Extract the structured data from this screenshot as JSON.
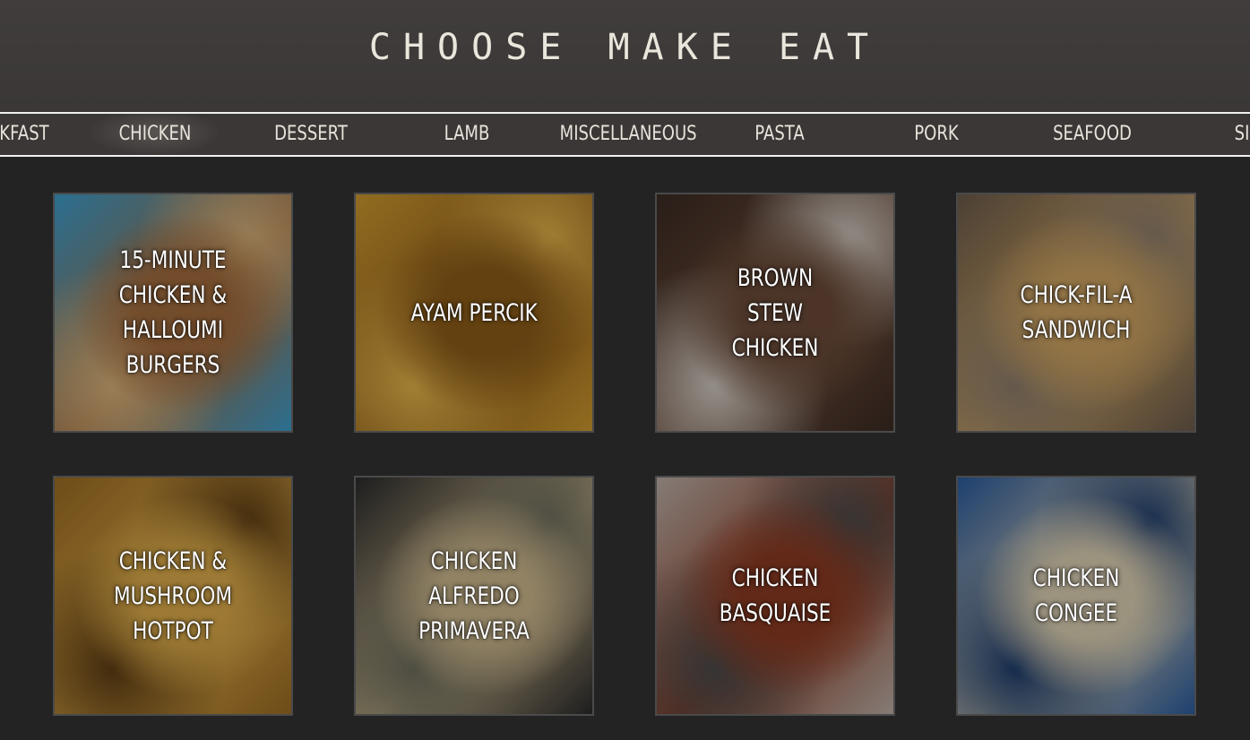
{
  "header": {
    "title": "CHOOSE MAKE EAT"
  },
  "nav": {
    "items": [
      {
        "label": "KFAST",
        "active": false
      },
      {
        "label": "CHICKEN",
        "active": true
      },
      {
        "label": "DESSERT",
        "active": false
      },
      {
        "label": "LAMB",
        "active": false
      },
      {
        "label": "MISCELLANEOUS",
        "active": false
      },
      {
        "label": "PASTA",
        "active": false
      },
      {
        "label": "PORK",
        "active": false
      },
      {
        "label": "SEAFOOD",
        "active": false
      },
      {
        "label": "SID",
        "active": false
      }
    ]
  },
  "recipes": [
    {
      "title": "15-MINUTE CHICKEN & HALLOUMI BURGERS",
      "image": "burger-on-board",
      "colors": [
        "#3c9ac8",
        "#a06a3c",
        "#d4b07a"
      ]
    },
    {
      "title": "AYAM PERCIK",
      "image": "grilled-chicken-fork",
      "colors": [
        "#c9962e",
        "#8a5a18",
        "#e2b44a"
      ]
    },
    {
      "title": "BROWN STEW CHICKEN",
      "image": "stew-bowl",
      "colors": [
        "#3a2a22",
        "#6a4a38",
        "#cfc8c0"
      ]
    },
    {
      "title": "CHICK-FIL-A SANDWICH",
      "image": "chicken-sandwich",
      "colors": [
        "#6a5a4a",
        "#c9a060",
        "#8a7a6a"
      ]
    },
    {
      "title": "CHICKEN & MUSHROOM HOTPOT",
      "image": "potato-hotpot",
      "colors": [
        "#9a6a22",
        "#d8a848",
        "#5a3a12"
      ]
    },
    {
      "title": "CHICKEN ALFREDO PRIMAVERA",
      "image": "pasta-skillet",
      "colors": [
        "#2a2a2a",
        "#c8b48a",
        "#6a6a5a"
      ]
    },
    {
      "title": "CHICKEN BASQUAISE",
      "image": "casserole-dish",
      "colors": [
        "#b8aca4",
        "#8a3a22",
        "#4a4a4a"
      ]
    },
    {
      "title": "CHICKEN CONGEE",
      "image": "congee-bowl",
      "colors": [
        "#2a5a9a",
        "#d8ccb0",
        "#1a3a6a"
      ]
    }
  ]
}
